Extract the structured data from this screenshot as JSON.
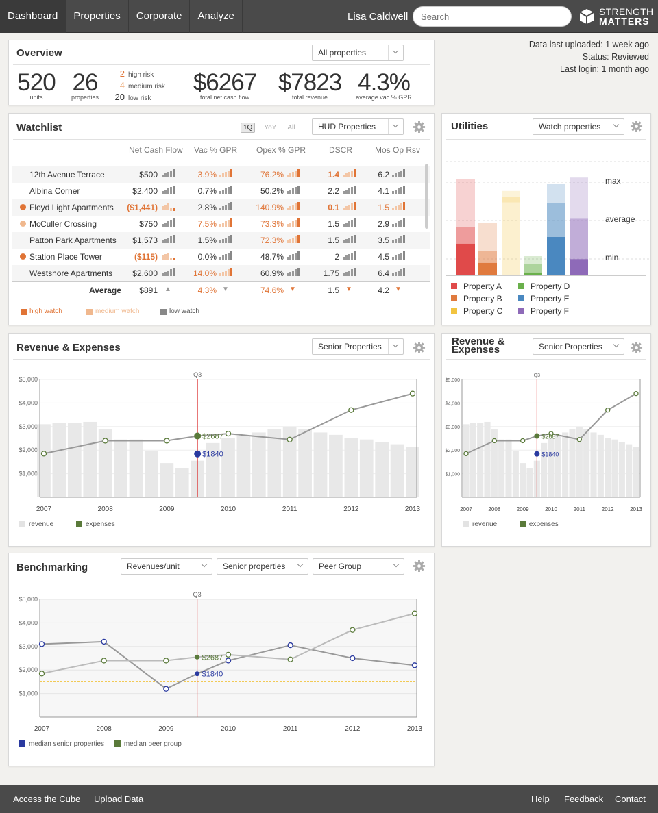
{
  "nav": {
    "items": [
      "Dashboard",
      "Properties",
      "Corporate",
      "Analyze"
    ],
    "user": "Lisa Caldwell",
    "search_placeholder": "Search",
    "logo_line1": "STRENGTH",
    "logo_line2": "MATTERS"
  },
  "status": {
    "uploaded": "Data last uploaded: 1 week ago",
    "status": "Status: Reviewed",
    "login": "Last login: 1 month ago"
  },
  "overview": {
    "title": "Overview",
    "filter": "All properties",
    "units": "520",
    "units_label": "units",
    "properties": "26",
    "properties_label": "properties",
    "risk": [
      {
        "n": "2",
        "label": "high risk"
      },
      {
        "n": "4",
        "label": "medium risk"
      },
      {
        "n": "20",
        "label": "low risk"
      }
    ],
    "net_cash": "$6267",
    "net_cash_label": "total net cash flow",
    "revenue": "$7823",
    "revenue_label": "total revenue",
    "vac": "4.3%",
    "vac_label": "average vac % GPR"
  },
  "watchlist": {
    "title": "Watchlist",
    "toggles": [
      "1Q",
      "YoY",
      "All"
    ],
    "filter": "HUD Properties",
    "columns": [
      "Net Cash Flow",
      "Vac % GPR",
      "Opex % GPR",
      "DSCR",
      "Mos Op Rsv"
    ],
    "rows": [
      {
        "name": "12th Avenue Terrace",
        "dot": "",
        "ncf": "$500",
        "vac": "3.9%",
        "opex": "76.2%",
        "dscr": "1.4",
        "mos": "6.2",
        "c_ncf": "n",
        "c_vac": "rd",
        "c_opex": "rd",
        "c_dscr": "rdb",
        "c_mos": "n"
      },
      {
        "name": "Albina Corner",
        "dot": "",
        "ncf": "$2,400",
        "vac": "0.7%",
        "opex": "50.2%",
        "dscr": "2.2",
        "mos": "4.1",
        "c_ncf": "n",
        "c_vac": "n",
        "c_opex": "n",
        "c_dscr": "n",
        "c_mos": "n"
      },
      {
        "name": "Floyd Light Apartments",
        "dot": "#e07436",
        "ncf": "($1,441)",
        "vac": "2.8%",
        "opex": "140.9%",
        "dscr": "0.1",
        "mos": "1.5",
        "c_ncf": "rdb",
        "c_vac": "n",
        "c_opex": "rd",
        "c_dscr": "rdb",
        "c_mos": "rd"
      },
      {
        "name": "McCuller Crossing",
        "dot": "#f0b88e",
        "ncf": "$750",
        "vac": "7.5%",
        "opex": "73.3%",
        "dscr": "1.5",
        "mos": "2.9",
        "c_ncf": "n",
        "c_vac": "rd",
        "c_opex": "rd",
        "c_dscr": "n",
        "c_mos": "n"
      },
      {
        "name": "Patton Park Apartments",
        "dot": "",
        "ncf": "$1,573",
        "vac": "1.5%",
        "opex": "72.3%",
        "dscr": "1.5",
        "mos": "3.5",
        "c_ncf": "n",
        "c_vac": "n",
        "c_opex": "rd",
        "c_dscr": "n",
        "c_mos": "n"
      },
      {
        "name": "Station Place Tower",
        "dot": "#e07436",
        "ncf": "($115)",
        "vac": "0.0%",
        "opex": "48.7%",
        "dscr": "2",
        "mos": "4.5",
        "c_ncf": "rdb",
        "c_vac": "n",
        "c_opex": "n",
        "c_dscr": "n",
        "c_mos": "n"
      },
      {
        "name": "Westshore Apartments",
        "dot": "",
        "ncf": "$2,600",
        "vac": "14.0%",
        "opex": "60.9%",
        "dscr": "1.75",
        "mos": "6.4",
        "c_ncf": "n",
        "c_vac": "rd",
        "c_opex": "n",
        "c_dscr": "n",
        "c_mos": "n"
      }
    ],
    "average": {
      "label": "Average",
      "ncf": "$891",
      "vac": "4.3%",
      "opex": "74.6%",
      "dscr": "1.5",
      "mos": "4.2"
    },
    "legend": [
      {
        "label": "high watch",
        "color": "#e07436"
      },
      {
        "label": "medium watch",
        "color": "#f0b88e"
      },
      {
        "label": "low watch",
        "color": "#888888"
      }
    ]
  },
  "utilities": {
    "title": "Utilities",
    "filter": "Watch properties",
    "markers": [
      "max",
      "average",
      "min"
    ],
    "legend": [
      {
        "label": "Property A",
        "color": "#e04a4a"
      },
      {
        "label": "Property D",
        "color": "#6ab04c"
      },
      {
        "label": "Property B",
        "color": "#e07a3e"
      },
      {
        "label": "Property E",
        "color": "#4a88c0"
      },
      {
        "label": "Property C",
        "color": "#f2c440"
      },
      {
        "label": "Property F",
        "color": "#8e6ab8"
      }
    ]
  },
  "revexp": {
    "title": "Revenue & Expenses",
    "title_small_1": "Revenue &",
    "title_small_2": "Expenses",
    "filter": "Senior Properties",
    "marker": "Q3",
    "label_a": "$2687",
    "label_b": "$1840",
    "legend": [
      {
        "label": "revenue",
        "color": "#e3e3e3"
      },
      {
        "label": "expenses",
        "color": "#5a7a3a"
      }
    ]
  },
  "benchmark": {
    "title": "Benchmarking",
    "filters": [
      "Revenues/unit",
      "Senior properties",
      "Peer Group"
    ],
    "marker": "Q3",
    "label_a": "$2687",
    "label_b": "$1840",
    "legend": [
      {
        "label": "median senior properties",
        "color": "#2a3aa0"
      },
      {
        "label": "median peer group",
        "color": "#5a7a3a"
      }
    ]
  },
  "chart_data": [
    {
      "type": "bar",
      "title": "Revenue & Expenses",
      "x_ticks": [
        "2007",
        "2008",
        "2009",
        "2010",
        "2011",
        "2012",
        "2013"
      ],
      "y_ticks": [
        "$1,000",
        "$2,000",
        "$3,000",
        "$4,000",
        "$5,000"
      ],
      "ylim": [
        0,
        5000
      ],
      "series": [
        {
          "name": "revenue",
          "x": [
            2007.0,
            2007.25,
            2007.5,
            2007.75,
            2008.0,
            2008.25,
            2008.5,
            2008.75,
            2009.0,
            2009.25,
            2009.5,
            2009.75,
            2010.0,
            2010.25,
            2010.5,
            2010.75,
            2011.0,
            2011.25,
            2011.5,
            2011.75,
            2012.0,
            2012.25,
            2012.5,
            2012.75,
            2013.0
          ],
          "values": [
            3100,
            3150,
            3150,
            3200,
            2900,
            2450,
            2450,
            1950,
            1450,
            1250,
            1550,
            2300,
            2500,
            2600,
            2750,
            2900,
            3000,
            2900,
            2750,
            2650,
            2500,
            2450,
            2350,
            2250,
            2150
          ]
        },
        {
          "name": "expenses",
          "x": [
            2007,
            2008,
            2009,
            2009.5,
            2010,
            2011,
            2012,
            2013
          ],
          "values": [
            1850,
            2400,
            2400,
            2600,
            2700,
            2450,
            3700,
            4400
          ]
        }
      ],
      "annotations": [
        {
          "label": "Q3",
          "x": 2009.5
        },
        {
          "label": "$2687",
          "value": 2687
        },
        {
          "label": "$1840",
          "value": 1840
        }
      ]
    },
    {
      "type": "line",
      "title": "Benchmarking",
      "x_ticks": [
        "2007",
        "2008",
        "2009",
        "2010",
        "2011",
        "2012",
        "2013"
      ],
      "y_ticks": [
        "$1,000",
        "$2,000",
        "$3,000",
        "$4,000",
        "$5,000"
      ],
      "ylim": [
        0,
        5000
      ],
      "series": [
        {
          "name": "median senior properties",
          "x": [
            2007,
            2008,
            2009,
            2009.5,
            2010,
            2011,
            2012,
            2013
          ],
          "values": [
            3100,
            3200,
            1200,
            1840,
            2400,
            3050,
            2500,
            2200
          ]
        },
        {
          "name": "median peer group",
          "x": [
            2007,
            2008,
            2009,
            2009.5,
            2010,
            2011,
            2012,
            2013
          ],
          "values": [
            1850,
            2400,
            2400,
            2550,
            2650,
            2450,
            3700,
            4400
          ]
        }
      ],
      "reference_line": 1500
    },
    {
      "type": "bar",
      "title": "Utilities",
      "categories": [
        "Property A",
        "Property B",
        "Property C",
        "Property D",
        "Property E",
        "Property F"
      ],
      "stacks": [
        [
          0.33,
          0.17,
          0.5
        ],
        [
          0.13,
          0.12,
          0.3
        ],
        [
          0.0,
          0.0,
          0.76,
          0.06,
          0.06
        ],
        [
          0.03,
          0.09,
          0.08
        ],
        [
          0.4,
          0.35,
          0.2
        ],
        [
          0.17,
          0.42,
          0.43
        ]
      ]
    }
  ]
}
